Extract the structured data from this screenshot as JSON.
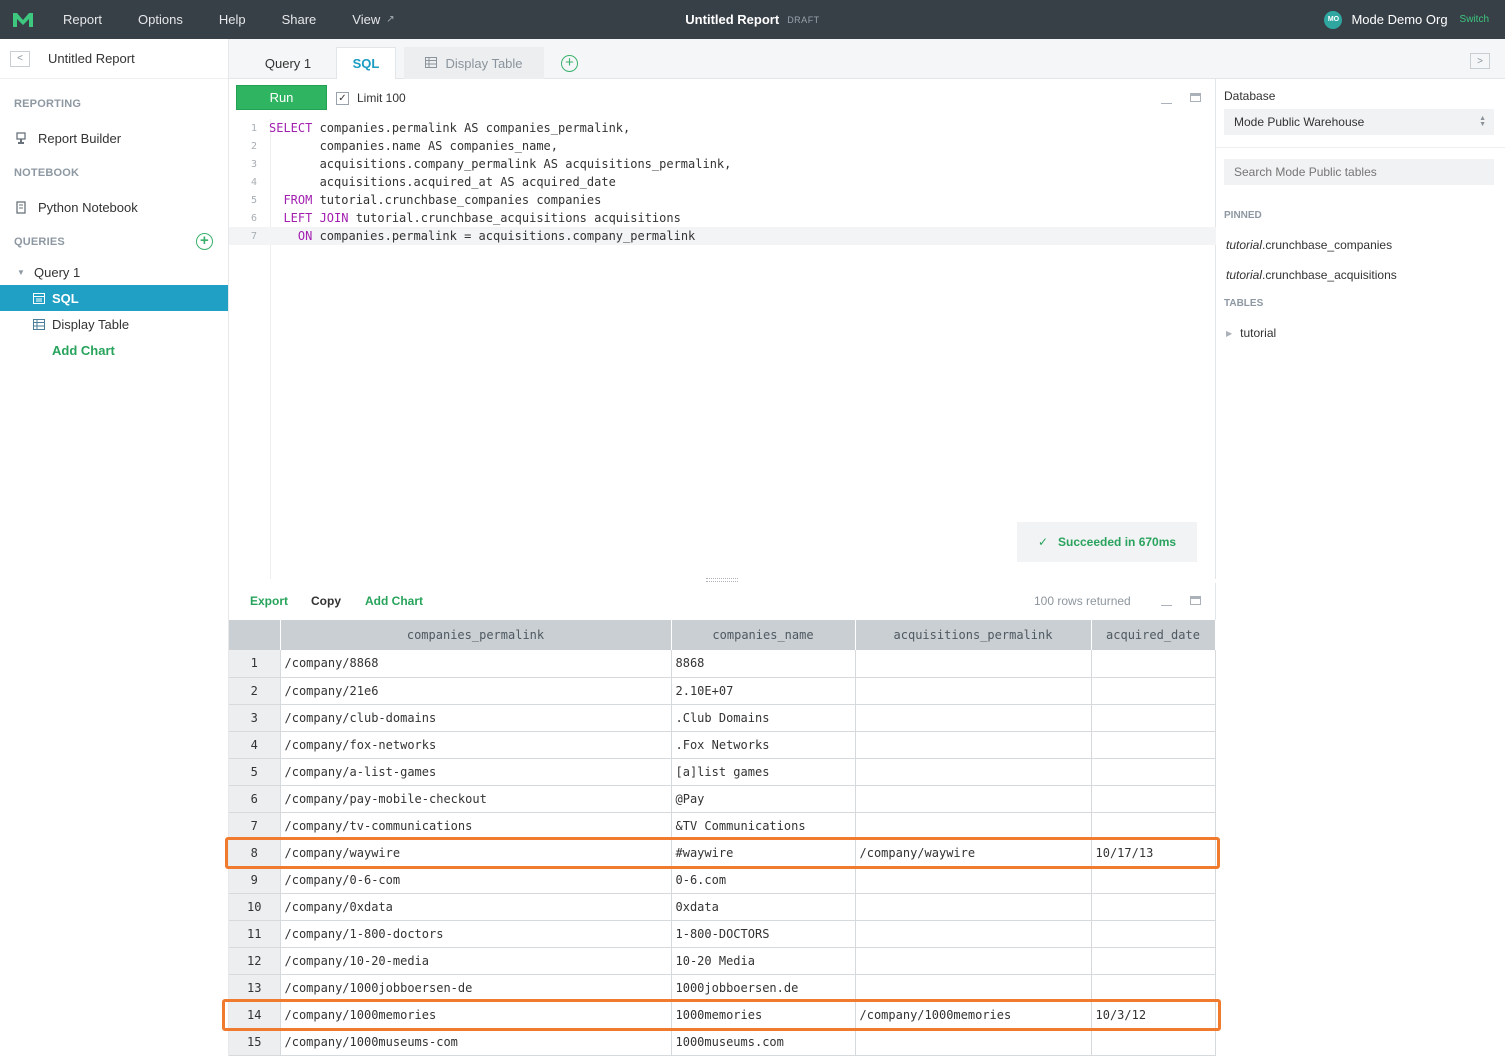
{
  "topbar": {
    "nav": [
      "Report",
      "Options",
      "Help",
      "Share",
      "View"
    ],
    "view_ext_icon": "external-link-icon",
    "title": "Untitled Report",
    "draft": "DRAFT",
    "org_initials": "MO",
    "org_name": "Mode Demo Org",
    "switch": "Switch",
    "colors": {
      "bar": "#373f47",
      "accent": "#3ec77f"
    }
  },
  "sidebar": {
    "title": "Untitled Report",
    "reporting_label": "REPORTING",
    "report_builder": "Report Builder",
    "notebook_label": "NOTEBOOK",
    "python_notebook": "Python Notebook",
    "queries_label": "QUERIES",
    "query_name": "Query 1",
    "sql_item": "SQL",
    "display_table_item": "Display Table",
    "add_chart": "Add Chart"
  },
  "tabs": {
    "query": "Query 1",
    "sql": "SQL",
    "display_table": "Display Table"
  },
  "editor": {
    "run": "Run",
    "limit_label": "Limit 100",
    "limit_checked": true,
    "lines": [
      {
        "n": "1",
        "indent": "",
        "kw": "SELECT",
        "rest": " companies.permalink AS companies_permalink,"
      },
      {
        "n": "2",
        "indent": "       ",
        "kw": "",
        "rest": "companies.name AS companies_name,"
      },
      {
        "n": "3",
        "indent": "       ",
        "kw": "",
        "rest": "acquisitions.company_permalink AS acquisitions_permalink,"
      },
      {
        "n": "4",
        "indent": "       ",
        "kw": "",
        "rest": "acquisitions.acquired_at AS acquired_date"
      },
      {
        "n": "5",
        "indent": "  ",
        "kw": "FROM",
        "rest": " tutorial.crunchbase_companies companies"
      },
      {
        "n": "6",
        "indent": "  ",
        "kw": "LEFT JOIN",
        "rest": " tutorial.crunchbase_acquisitions acquisitions"
      },
      {
        "n": "7",
        "indent": "    ",
        "kw": "ON",
        "rest": " companies.permalink = acquisitions.company_permalink"
      }
    ],
    "status": "Succeeded in 670ms"
  },
  "right_panel": {
    "database_label": "Database",
    "database_value": "Mode Public Warehouse",
    "search_placeholder": "Search Mode Public tables",
    "pinned_label": "PINNED",
    "pinned_schema": "tutorial",
    "pinned": [
      ".crunchbase_companies",
      ".crunchbase_acquisitions"
    ],
    "tables_label": "TABLES",
    "tables": [
      "tutorial"
    ]
  },
  "results": {
    "export": "Export",
    "copy": "Copy",
    "add_chart": "Add Chart",
    "rows_returned": "100 rows returned",
    "columns": [
      "companies_permalink",
      "companies_name",
      "acquisitions_permalink",
      "acquired_date"
    ],
    "rows": [
      [
        "1",
        "/company/8868",
        "8868",
        "",
        ""
      ],
      [
        "2",
        "/company/21e6",
        "2.10E+07",
        "",
        ""
      ],
      [
        "3",
        "/company/club-domains",
        ".Club Domains",
        "",
        ""
      ],
      [
        "4",
        "/company/fox-networks",
        ".Fox Networks",
        "",
        ""
      ],
      [
        "5",
        "/company/a-list-games",
        "[a]list games",
        "",
        ""
      ],
      [
        "6",
        "/company/pay-mobile-checkout",
        "@Pay",
        "",
        ""
      ],
      [
        "7",
        "/company/tv-communications",
        "&TV Communications",
        "",
        ""
      ],
      [
        "8",
        "/company/waywire",
        "#waywire",
        "/company/waywire",
        "10/17/13"
      ],
      [
        "9",
        "/company/0-6-com",
        "0-6.com",
        "",
        ""
      ],
      [
        "10",
        "/company/0xdata",
        "0xdata",
        "",
        ""
      ],
      [
        "11",
        "/company/1-800-doctors",
        "1-800-DOCTORS",
        "",
        ""
      ],
      [
        "12",
        "/company/10-20-media",
        "10-20 Media",
        "",
        ""
      ],
      [
        "13",
        "/company/1000jobboersen-de",
        "1000jobboersen.de",
        "",
        ""
      ],
      [
        "14",
        "/company/1000memories",
        "1000memories",
        "/company/1000memories",
        "10/3/12"
      ],
      [
        "15",
        "/company/1000museums-com",
        "1000museums.com",
        "",
        ""
      ]
    ],
    "highlighted_rows": [
      "8",
      "14"
    ],
    "highlight_color": "#f07a2d"
  }
}
